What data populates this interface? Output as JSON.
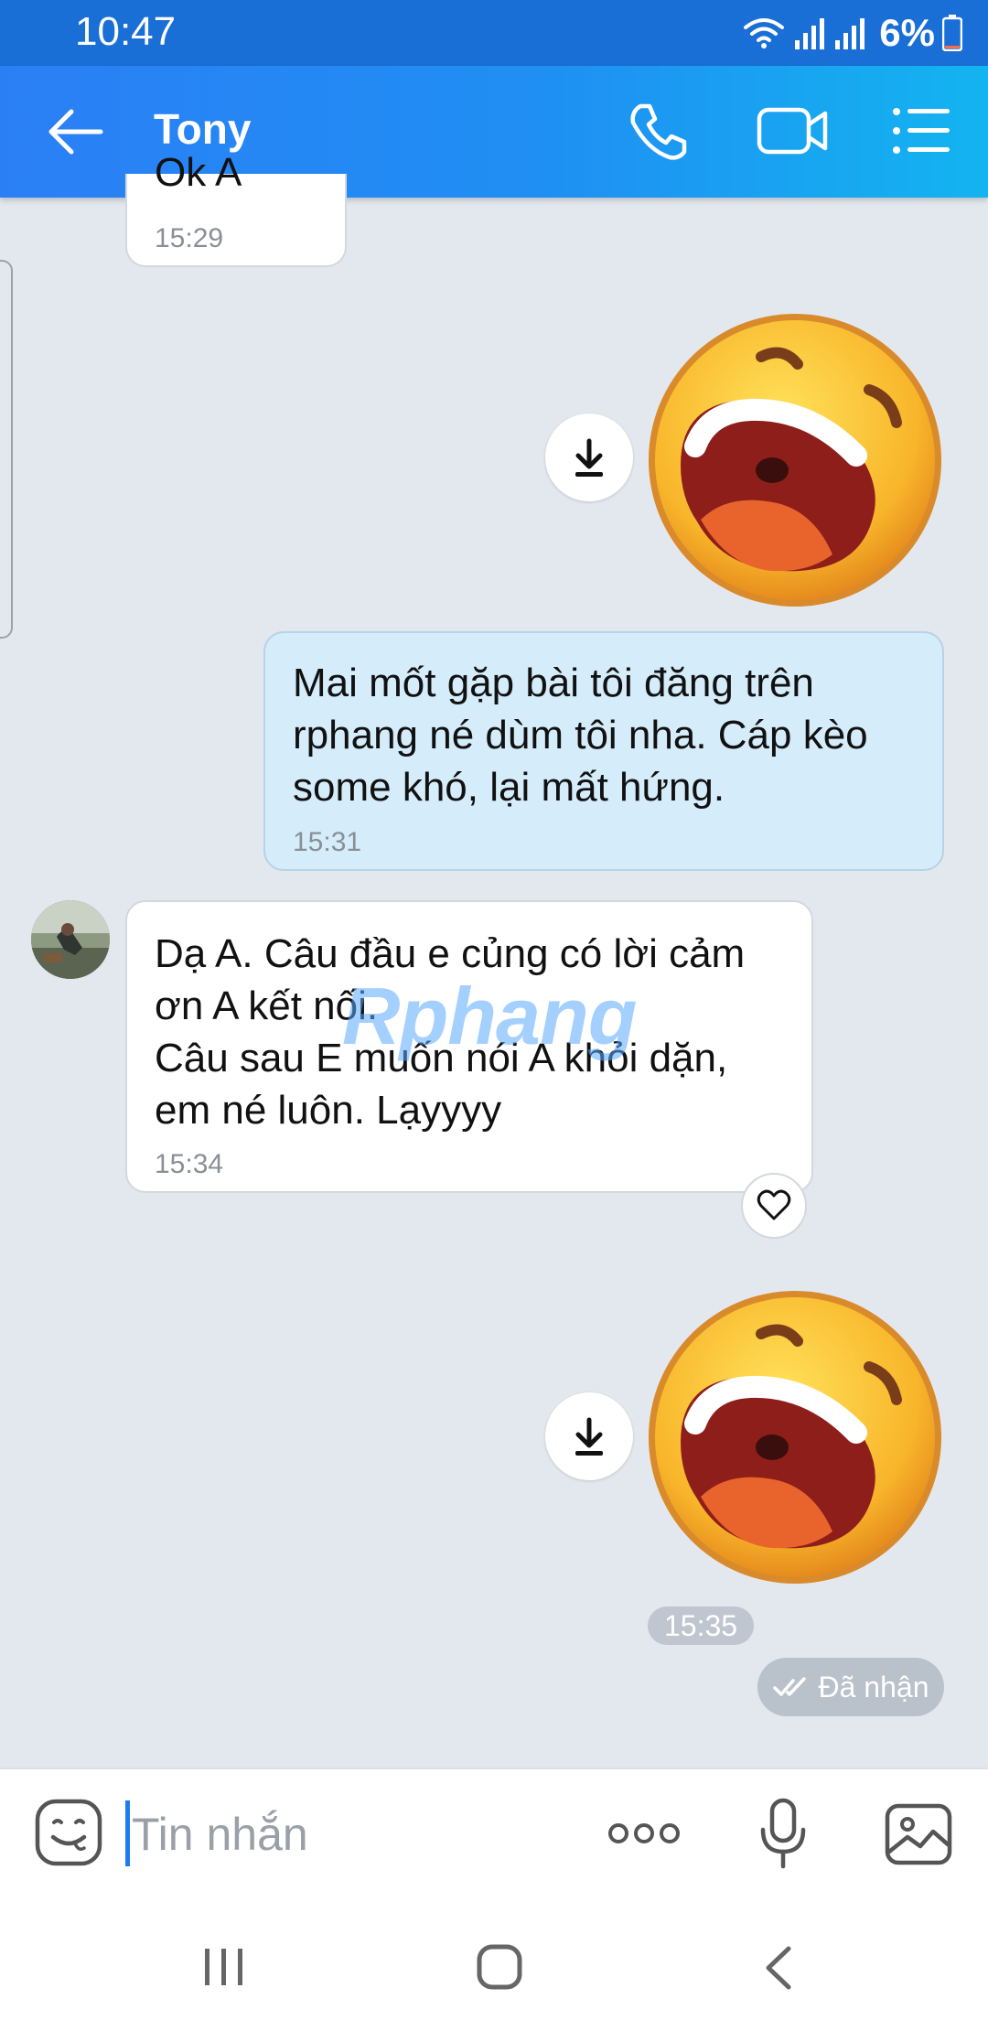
{
  "status_bar": {
    "time": "10:47",
    "battery_percent": "6%",
    "battery_level": 0.06,
    "icons": [
      "wifi-icon",
      "signal-icon",
      "signal-icon",
      "battery-icon"
    ]
  },
  "header": {
    "contact_name": "Tony",
    "icons": [
      "back-arrow-icon",
      "phone-icon",
      "video-camera-icon",
      "list-menu-icon"
    ]
  },
  "messages": {
    "top_partial": {
      "text": "Ok A",
      "time": "15:29"
    },
    "sticker_1": {
      "icon": "laughing-emoji-sticker",
      "download_icon": "download-icon"
    },
    "outgoing": {
      "text": "Mai mốt gặp bài tôi đăng trên\nrphang né dùm tôi nha. Cáp kèo\nsome khó, lại mất hứng.",
      "time": "15:31"
    },
    "incoming": {
      "text": "Dạ A. Câu đầu e củng có lời cảm\nơn A kết nối.\nCâu sau E muốn nói A khỏi dặn,\nem né luôn. Lạyyyy",
      "time": "15:34",
      "reaction_icon": "heart-icon"
    },
    "sticker_2": {
      "icon": "laughing-emoji-sticker",
      "download_icon": "download-icon"
    },
    "sticker_2_time": "15:35",
    "delivery_status": "Đã nhận"
  },
  "watermark": "Rphang",
  "input_bar": {
    "placeholder": "Tin nhắn",
    "icons": [
      "emoji-icon",
      "more-dots-icon",
      "microphone-icon",
      "image-icon"
    ]
  },
  "nav_bar": {
    "icons": [
      "recents-icon",
      "home-icon",
      "back-chevron-icon"
    ]
  },
  "colors": {
    "header_start": "#2b7ff5",
    "header_end": "#13b4f0",
    "chat_background": "#e3e8ef",
    "outgoing_bubble": "#d5ecfb",
    "incoming_bubble": "#ffffff",
    "accent": "#1d7af0"
  }
}
